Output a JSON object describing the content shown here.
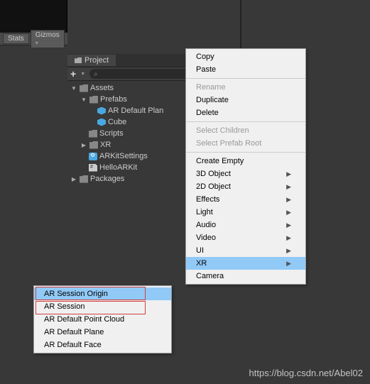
{
  "toolbar": {
    "stats": "Stats",
    "gizmos": "Gizmos"
  },
  "project": {
    "tab": "Project",
    "tree": {
      "assets": "Assets",
      "prefabs": "Prefabs",
      "ar_default_plan": "AR Default Plan",
      "cube": "Cube",
      "scripts": "Scripts",
      "xr": "XR",
      "arkitsettings": "ARKitSettings",
      "helloarkit": "HelloARKit",
      "packages": "Packages"
    }
  },
  "menu": {
    "copy": "Copy",
    "paste": "Paste",
    "rename": "Rename",
    "duplicate": "Duplicate",
    "delete": "Delete",
    "select_children": "Select Children",
    "select_prefab_root": "Select Prefab Root",
    "create_empty": "Create Empty",
    "3d_object": "3D Object",
    "2d_object": "2D Object",
    "effects": "Effects",
    "light": "Light",
    "audio": "Audio",
    "video": "Video",
    "ui": "UI",
    "xr": "XR",
    "camera": "Camera"
  },
  "submenu": {
    "ar_session_origin": "AR Session Origin",
    "ar_session": "AR Session",
    "ar_default_point_cloud": "AR Default Point Cloud",
    "ar_default_plane": "AR Default Plane",
    "ar_default_face": "AR Default Face"
  },
  "watermark": "https://blog.csdn.net/Abel02"
}
